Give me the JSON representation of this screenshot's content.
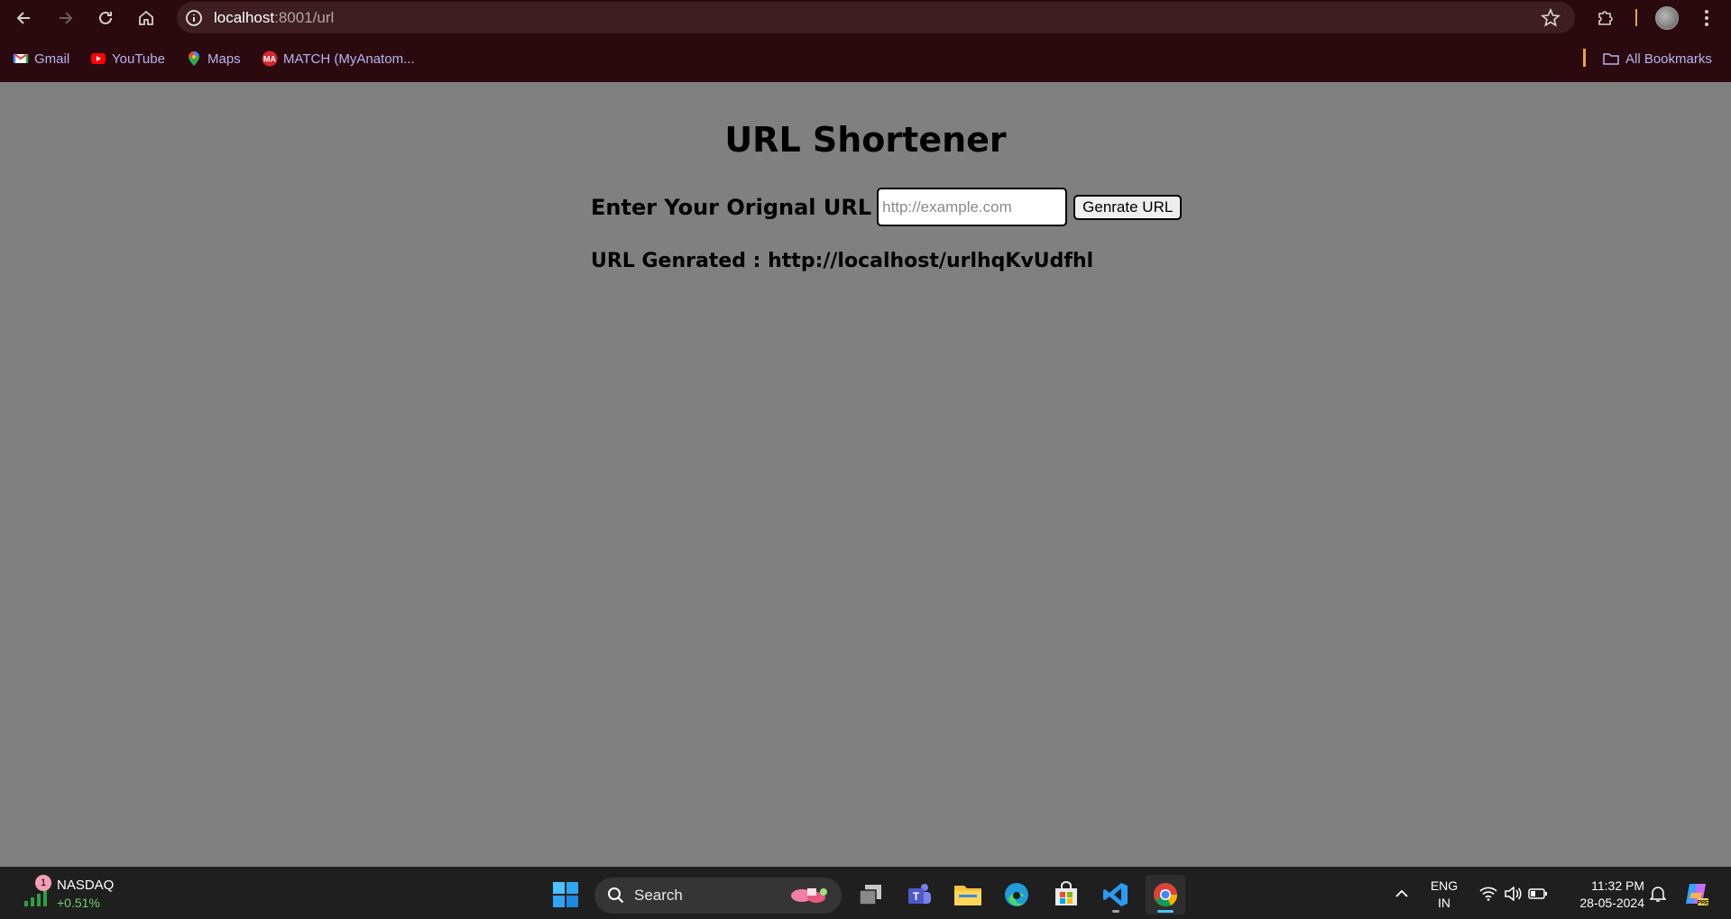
{
  "browser": {
    "url_host": "localhost",
    "url_path": ":8001/url",
    "bookmarks": [
      {
        "label": "Gmail",
        "icon": "gmail-icon"
      },
      {
        "label": "YouTube",
        "icon": "youtube-icon"
      },
      {
        "label": "Maps",
        "icon": "maps-icon"
      },
      {
        "label": "MATCH (MyAnatom...",
        "icon": "myanatomy-icon"
      }
    ],
    "all_bookmarks": "All Bookmarks"
  },
  "page": {
    "title": "URL Shortener",
    "input_label": "Enter Your Orignal URL",
    "input_placeholder": "http://example.com",
    "input_value": "",
    "button_label": "Genrate URL",
    "result_text": "URL Genrated : http://localhost/urlhqKvUdfhl"
  },
  "taskbar": {
    "stock_badge": "1",
    "stock_name": "NASDAQ",
    "stock_change": "+0.51%",
    "search_label": "Search",
    "lang_line1": "ENG",
    "lang_line2": "IN",
    "time": "11:32 PM",
    "date": "28-05-2024"
  },
  "colors": {
    "page_background": "#808080",
    "browser_frame": "#2a0a0f",
    "omnibox": "#3e1e23",
    "taskbar": "#1f1f1f",
    "stock_up": "#6ed26e"
  }
}
